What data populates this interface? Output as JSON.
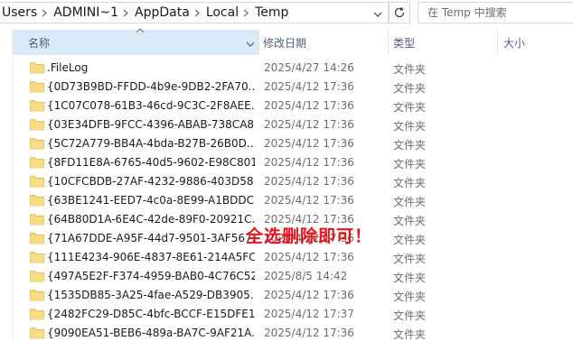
{
  "address": {
    "crumbs": [
      "Users",
      "ADMINI~1",
      "AppData",
      "Local",
      "Temp"
    ],
    "search_placeholder": "在 Temp 中搜索"
  },
  "columns": {
    "name": "名称",
    "date": "修改日期",
    "type": "类型",
    "size": "大小"
  },
  "files": [
    {
      "name": ".FileLog",
      "date": "2025/4/27 14:26",
      "type": "文件夹"
    },
    {
      "name": "{0D73B9BD-FFDD-4b9e-9DB2-2FA70...",
      "date": "2025/4/12 17:36",
      "type": "文件夹"
    },
    {
      "name": "{1C07C078-61B3-46cd-9C3C-2F8AEE...",
      "date": "2025/4/12 17:36",
      "type": "文件夹"
    },
    {
      "name": "{03E34DFB-9FCC-4396-ABAB-738CA8...",
      "date": "2025/4/12 17:36",
      "type": "文件夹"
    },
    {
      "name": "{5C72A779-BB4A-4bda-B27B-26B0D...",
      "date": "2025/4/12 17:36",
      "type": "文件夹"
    },
    {
      "name": "{8FD11E8A-6765-40d5-9602-E98C801...",
      "date": "2025/4/12 17:36",
      "type": "文件夹"
    },
    {
      "name": "{10CFCBDB-27AF-4232-9886-403D58...",
      "date": "2025/4/12 17:36",
      "type": "文件夹"
    },
    {
      "name": "{63BE1241-EED7-4c0a-8E99-A1BDDC...",
      "date": "2025/4/12 17:36",
      "type": "文件夹"
    },
    {
      "name": "{64B80D1A-6E4C-42de-89F0-20921C...",
      "date": "2025/4/12 17:36",
      "type": "文件夹"
    },
    {
      "name": "{71A67DDE-A95F-44d7-9501-3AF567...",
      "date": "2025/4/12 17:36",
      "type": "文件夹"
    },
    {
      "name": "{111E4234-906E-4837-8E61-214A5FC...",
      "date": "2025/4/12 17:36",
      "type": "文件夹"
    },
    {
      "name": "{497A5E2F-F374-4959-BAB0-4C76C52...",
      "date": "2025/8/5 14:42",
      "type": "文件夹"
    },
    {
      "name": "{1535DB85-3A25-4fae-A529-DB3905...",
      "date": "2025/4/12 17:36",
      "type": "文件夹"
    },
    {
      "name": "{2482FC29-D85C-4bfc-BCCF-E15DFE1...",
      "date": "2025/4/12 17:37",
      "type": "文件夹"
    },
    {
      "name": "{9090EA51-BEB6-489a-BA7C-9AF21A...",
      "date": "2025/4/12 17:36",
      "type": "文件夹"
    }
  ],
  "annotation": "全选删除即可！",
  "colors": {
    "header_selected": "#d9ebf9",
    "folder": "#f8d775",
    "annotation": "#e8121a"
  }
}
